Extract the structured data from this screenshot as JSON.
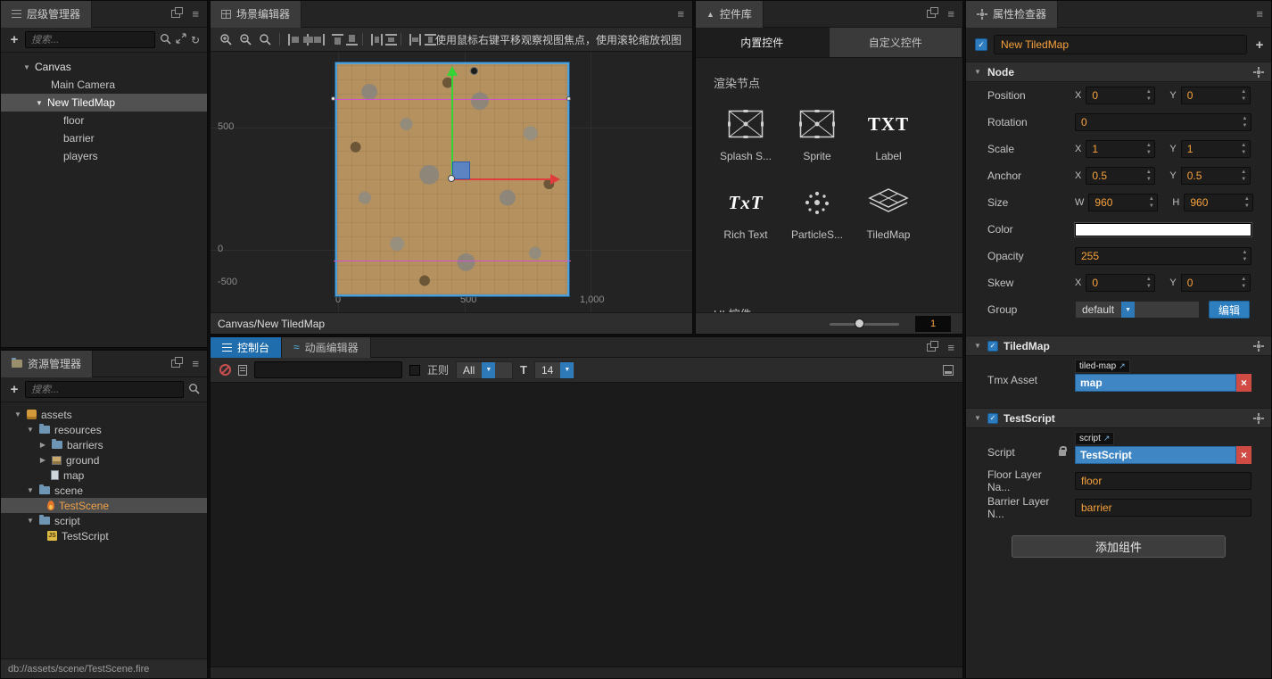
{
  "icons": {
    "plus": "+",
    "menu": "≡",
    "collapse": "▼",
    "expand": "▶",
    "refresh": "↻",
    "close": "×",
    "caret": "▼",
    "check": "✓",
    "triangle_up": "▲",
    "wave": "≈",
    "font_size": "T",
    "ext_link": "↗"
  },
  "hierarchy": {
    "title": "层级管理器",
    "search_placeholder": "搜索...",
    "items": [
      "Canvas",
      "Main Camera",
      "New TiledMap",
      "floor",
      "barrier",
      "players"
    ]
  },
  "assets": {
    "title": "资源管理器",
    "search_placeholder": "搜索...",
    "items": [
      "assets",
      "resources",
      "barriers",
      "ground",
      "map",
      "scene",
      "TestScene",
      "script",
      "TestScript"
    ],
    "status_path": "db://assets/scene/TestScene.fire"
  },
  "scene": {
    "title": "场景编辑器",
    "tip": "使用鼠标右键平移观察视图焦点，使用滚轮缩放视图",
    "breadcrumb": "Canvas/New TiledMap",
    "ruler_left": [
      "500",
      "0",
      "-500"
    ],
    "ruler_bottom": [
      "0",
      "500",
      "1,000"
    ]
  },
  "widgets": {
    "title": "控件库",
    "tab_builtin": "内置控件",
    "tab_custom": "自定义控件",
    "section_render": "渲染节点",
    "section_next": "UI 控件",
    "items": [
      "Splash S...",
      "Sprite",
      "Label",
      "Rich Text",
      "ParticleS...",
      "TiledMap"
    ],
    "label_icon_text": "TXT",
    "richtext_icon_text": "TxT",
    "zoom_value": "1"
  },
  "console": {
    "tab_console": "控制台",
    "tab_anim": "动画编辑器",
    "regex_label": "正则",
    "filter_value": "All",
    "fontsize_value": "14"
  },
  "inspector": {
    "title": "属性检查器",
    "node_name": "New TiledMap",
    "node": {
      "title": "Node",
      "x": "X",
      "y": "Y",
      "w": "W",
      "h": "H",
      "position_label": "Position",
      "position_x": "0",
      "position_y": "0",
      "rotation_label": "Rotation",
      "rotation": "0",
      "scale_label": "Scale",
      "scale_x": "1",
      "scale_y": "1",
      "anchor_label": "Anchor",
      "anchor_x": "0.5",
      "anchor_y": "0.5",
      "size_label": "Size",
      "size_w": "960",
      "size_h": "960",
      "color_label": "Color",
      "opacity_label": "Opacity",
      "opacity": "255",
      "skew_label": "Skew",
      "skew_x": "0",
      "skew_y": "0",
      "group_label": "Group",
      "group_value": "default",
      "group_edit": "编辑"
    },
    "tiledmap": {
      "title": "TiledMap",
      "tmx_label": "Tmx Asset",
      "badge": "tiled-map",
      "value": "map"
    },
    "testscript": {
      "title": "TestScript",
      "script_label": "Script",
      "badge": "script",
      "value": "TestScript",
      "floor_label": "Floor Layer Na...",
      "floor_value": "floor",
      "barrier_label": "Barrier Layer N...",
      "barrier_value": "barrier"
    },
    "add_component": "添加组件"
  }
}
